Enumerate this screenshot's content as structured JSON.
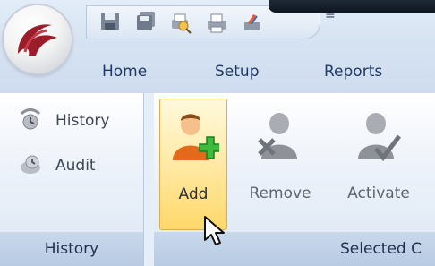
{
  "tabs": [
    "Home",
    "Setup",
    "Reports"
  ],
  "quick_access": {
    "icons": [
      "save-icon",
      "save-all-icon",
      "preview-icon",
      "print-icon",
      "tools-icon"
    ],
    "more_label": "="
  },
  "groups": {
    "history": {
      "label": "History",
      "items": [
        {
          "label": "History",
          "icon": "history-icon"
        },
        {
          "label": "Audit",
          "icon": "audit-icon"
        }
      ]
    },
    "selected": {
      "label": "Selected C",
      "buttons": [
        {
          "label": "Add",
          "icon": "add-user-icon",
          "state": "hover"
        },
        {
          "label": "Remove",
          "icon": "remove-user-icon",
          "state": "disabled"
        },
        {
          "label": "Activate",
          "icon": "activate-user-icon",
          "state": "disabled"
        }
      ]
    }
  },
  "colors": {
    "ribbon_bg": "#dfe9f5",
    "tab_text": "#1f3a66",
    "hover_gold": "#ffd86a",
    "add_plus": "#3dbb3d"
  }
}
